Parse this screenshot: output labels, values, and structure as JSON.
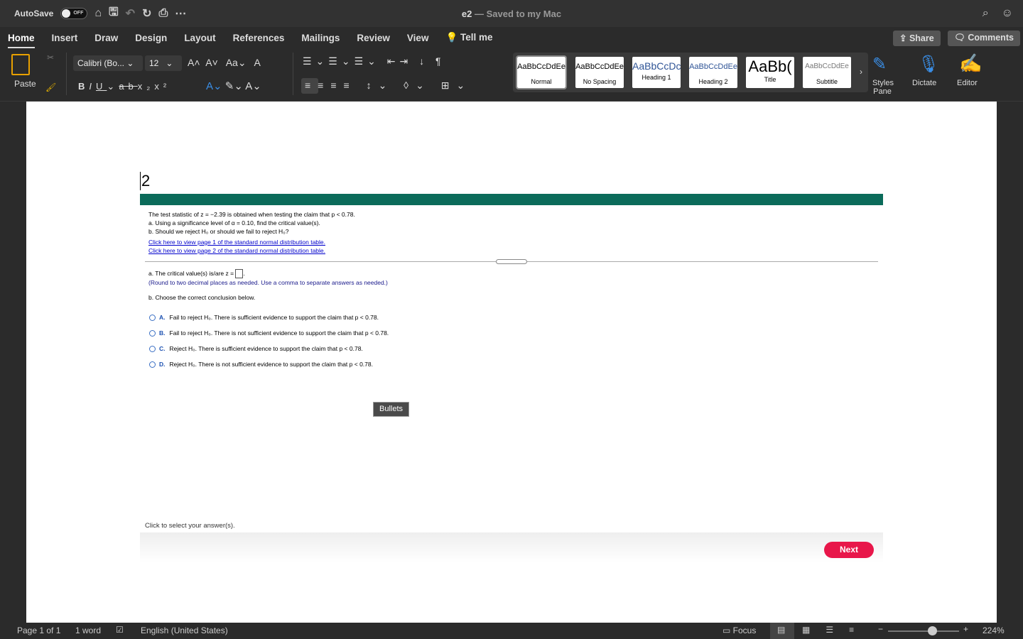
{
  "titlebar": {
    "autosave": "AutoSave",
    "toggle": "OFF",
    "doc_name": "e2",
    "saved": "— Saved to my Mac"
  },
  "tabs": [
    "Home",
    "Insert",
    "Draw",
    "Design",
    "Layout",
    "References",
    "Mailings",
    "Review",
    "View",
    "Tell me"
  ],
  "share": "Share",
  "comments": "Comments",
  "ribbon": {
    "paste": "Paste",
    "font": "Calibri (Bo...",
    "size": "12",
    "styles_pane": "Styles Pane",
    "dictate": "Dictate",
    "editor": "Editor",
    "styles": [
      {
        "preview": "AaBbCcDdEe",
        "name": "Normal"
      },
      {
        "preview": "AaBbCcDdEe",
        "name": "No Spacing"
      },
      {
        "preview": "AaBbCcDc",
        "name": "Heading 1"
      },
      {
        "preview": "AaBbCcDdEe",
        "name": "Heading 2"
      },
      {
        "preview": "AaBb(",
        "name": "Title"
      },
      {
        "preview": "AaBbCcDdEe",
        "name": "Subtitle"
      }
    ]
  },
  "doc": {
    "number": "2",
    "question": "The test statistic of z = −2.39 is obtained when testing the claim that p < 0.78.",
    "qa": "a. Using a significance level of α = 0.10, find the critical value(s).",
    "qb": "b. Should we reject H₀ or should we fail to reject H₀?",
    "link1": "Click here to view page 1 of the standard normal distribution table.",
    "link2": "Click here to view page 2 of the standard normal distribution table.",
    "ans_a": "a. The critical value(s) is/are z =",
    "hint": "(Round to two decimal places as needed. Use a comma to separate answers as needed.)",
    "ans_b": "b. Choose the correct conclusion below.",
    "options": [
      {
        "letter": "A.",
        "text": "Fail to reject H₀. There is sufficient evidence to support the claim that p < 0.78."
      },
      {
        "letter": "B.",
        "text": "Fail to reject H₀. There is not sufficient evidence to support the claim that p < 0.78."
      },
      {
        "letter": "C.",
        "text": "Reject H₀. There is sufficient evidence to support the claim that p < 0.78."
      },
      {
        "letter": "D.",
        "text": "Reject H₀. There is not sufficient evidence to support the claim that p < 0.78."
      }
    ],
    "tooltip": "Bullets",
    "footer": "Click to select your answer(s).",
    "next": "Next"
  },
  "status": {
    "page": "Page 1 of 1",
    "words": "1 word",
    "language": "English (United States)",
    "focus": "Focus",
    "zoom": "224%",
    "zoom_level": 0.62
  },
  "colors": {
    "teal": "#0b6b5a",
    "next": "#e8174a"
  }
}
